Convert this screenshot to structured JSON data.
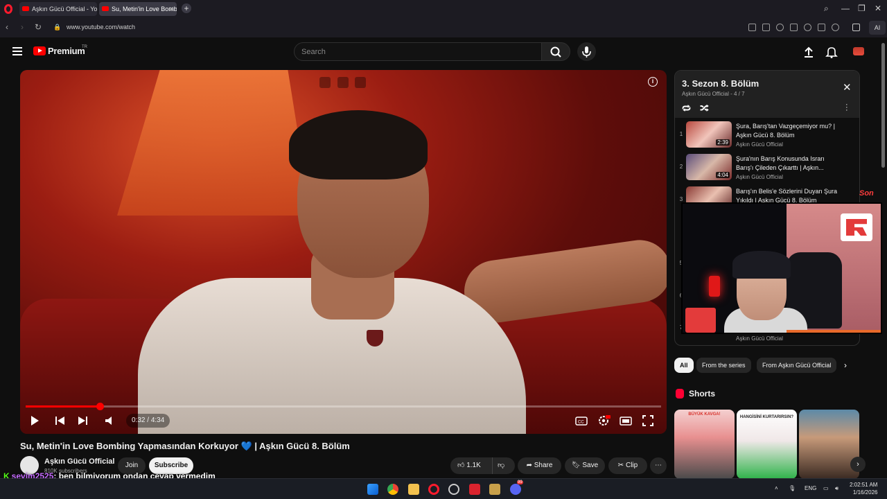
{
  "browser": {
    "tabs": [
      {
        "label": "Aşkın Gücü Official - YouT"
      },
      {
        "label": "Su, Metin'in Love Bombin"
      }
    ],
    "url": "www.youtube.com/watch",
    "ai_label": "AI"
  },
  "header": {
    "logo_text": "Premium",
    "country": "TR",
    "search_placeholder": "Search"
  },
  "player": {
    "current_time": "0:32",
    "separator": " / ",
    "duration": "4:34",
    "progress": 0.117
  },
  "video": {
    "title": "Su, Metin'in Love Bombing Yapmasından Korkuyor",
    "title_emoji": "💙",
    "title_suffix": "| Aşkın Gücü 8. Bölüm",
    "channel": "Aşkın Gücü Official",
    "subscribers": "810K subscribers",
    "join_label": "Join",
    "subscribe_label": "Subscribe",
    "likes": "1.1K",
    "share_label": "Share",
    "save_label": "Save",
    "clip_label": "Clip"
  },
  "playlist": {
    "title": "3. Sezon 8. Bölüm",
    "subtitle": "Aşkın Gücü Official - 4 / 7",
    "items": [
      {
        "num": "1",
        "title": "Şura, Barış'tan Vazgeçemiyor mu? | Aşkın Gücü 8. Bölüm",
        "channel": "Aşkın Gücü Official",
        "duration": "2:39"
      },
      {
        "num": "2",
        "title": "Şura'nın Barış Konusunda Israrı Barış'ı Çileden Çıkarttı | Aşkın...",
        "channel": "Aşkın Gücü Official",
        "duration": "4:04"
      },
      {
        "num": "3",
        "title": "Barış'ın Belis'e Sözlerini Duyan Şura Yıkıldı | Aşkın Gücü 8. Bölüm",
        "channel": "",
        "duration": ""
      }
    ],
    "hidden_nums": [
      "5",
      "6",
      "7"
    ],
    "last_channel": "Aşkın Gücü Official"
  },
  "overlay": {
    "son_text": "Son"
  },
  "chips": [
    "All",
    "From the series",
    "From Aşkın Gücü Official"
  ],
  "shorts": {
    "title": "Shorts",
    "items": [
      {
        "caption": "BÜYÜK KAVGA!"
      },
      {
        "caption": "HANGİSİNİ KURTARIRSIN?"
      },
      {
        "caption": ""
      }
    ]
  },
  "chat": {
    "user": "sevim2525",
    "message": ": ben bilmiyorum ondan cevap vermedim"
  },
  "taskbar": {
    "language": "ENG",
    "time": "2:02:51 AM",
    "date": "1/16/2026",
    "discord_badge": "99"
  },
  "colors": {
    "accent": "#ff0000",
    "background": "#0f0f0f",
    "chat_user": "#c56bff",
    "kick_green": "#53fc18"
  }
}
